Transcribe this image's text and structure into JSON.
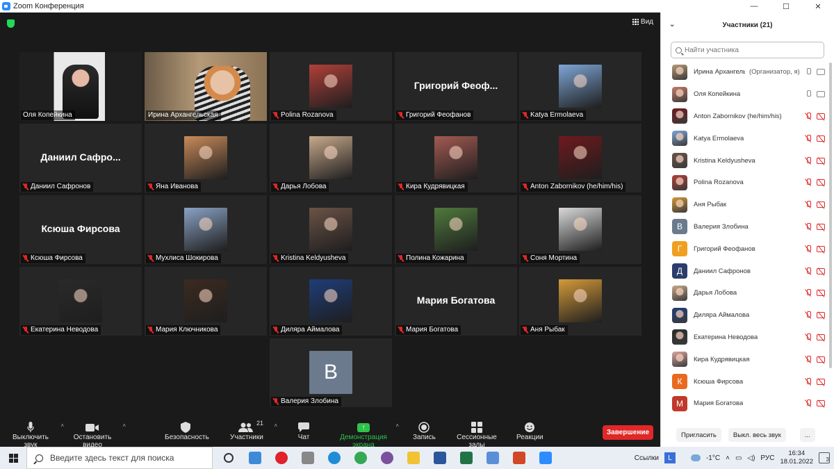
{
  "window": {
    "title": "Zoom Конференция",
    "min": "—",
    "max": "☐",
    "close": "✕"
  },
  "meeting": {
    "view_label": "Вид"
  },
  "tiles": [
    {
      "name": "Оля Копейкина",
      "muted": false,
      "active": true,
      "kind": "video",
      "color": "#e8e8e8"
    },
    {
      "name": "Ирина Архангельская",
      "muted": false,
      "kind": "video",
      "color": "#b59a78"
    },
    {
      "name": "Polina Rozanova",
      "muted": true,
      "kind": "photo",
      "color": "#b0403a"
    },
    {
      "name": "Григорий Феофанов",
      "muted": true,
      "kind": "text",
      "big": "Григорий Феоф..."
    },
    {
      "name": "Katya Ermolaeva",
      "muted": true,
      "kind": "photo",
      "color": "#7ea6d6"
    },
    {
      "name": "Даниил Сафронов",
      "muted": true,
      "kind": "text",
      "big": "Даниил Сафро..."
    },
    {
      "name": "Яна Иванова",
      "muted": true,
      "kind": "photo",
      "color": "#c98a5a"
    },
    {
      "name": "Дарья Лобова",
      "muted": true,
      "kind": "photo",
      "color": "#c7a98c"
    },
    {
      "name": "Кира Кудрявицкая",
      "muted": true,
      "kind": "photo",
      "color": "#a35a52"
    },
    {
      "name": "Anton Zabornikov (he/him/his)",
      "muted": true,
      "kind": "photo",
      "color": "#6e1a1e"
    },
    {
      "name": "Ксюша Фирсова",
      "muted": true,
      "kind": "text",
      "big": "Ксюша Фирсова"
    },
    {
      "name": "Мухлиса Шокирова",
      "muted": true,
      "kind": "photo",
      "color": "#8aa2c4"
    },
    {
      "name": "Kristina Keldyusheva",
      "muted": true,
      "kind": "photo",
      "color": "#6b5346"
    },
    {
      "name": "Полина Кожарина",
      "muted": true,
      "kind": "photo",
      "color": "#4f7a3d"
    },
    {
      "name": "Соня Мортина",
      "muted": true,
      "kind": "photo",
      "color": "#d9d9d9"
    },
    {
      "name": "Екатерина Неводова",
      "muted": true,
      "kind": "photo",
      "color": "#2a2a2a"
    },
    {
      "name": "Мария Ключникова",
      "muted": true,
      "kind": "photo",
      "color": "#3c2a20"
    },
    {
      "name": "Диляра Аймалова",
      "muted": true,
      "kind": "photo",
      "color": "#1f3d7a"
    },
    {
      "name": "Мария Богатова",
      "muted": true,
      "kind": "text",
      "big": "Мария Богатова"
    },
    {
      "name": "Аня Рыбак",
      "muted": true,
      "kind": "photo",
      "color": "#d49a3a"
    },
    {
      "name": "Валерия Злобина",
      "muted": true,
      "kind": "letter",
      "letter": "В",
      "color": "#6b7a8d"
    }
  ],
  "toolbar": {
    "mute": "Выключить звук",
    "video": "Остановить видео",
    "security": "Безопасность",
    "participants": "Участники",
    "participants_count": "21",
    "chat": "Чат",
    "share": "Демонстрация экрана",
    "record": "Запись",
    "rooms": "Сессионные залы",
    "reactions": "Реакции",
    "end": "Завершение"
  },
  "panel": {
    "title": "Участники (21)",
    "search_placeholder": "Найти участника",
    "invite": "Пригласить",
    "mute_all": "Выкл. весь звук",
    "more": "...",
    "participants": [
      {
        "name": "Ирина Архангельская",
        "role": "(Организатор, я)",
        "av": "#b59a78",
        "mic": "on",
        "cam": "on"
      },
      {
        "name": "Оля Копейкина",
        "role": "",
        "av": "#c47d6a",
        "mic": "on",
        "cam": "on"
      },
      {
        "name": "Anton Zabornikov (he/him/his)",
        "role": "",
        "av": "#6e1a1e",
        "mic": "off",
        "cam": "off"
      },
      {
        "name": "Katya Ermolaeva",
        "role": "",
        "av": "#7ea6d6",
        "mic": "off",
        "cam": "off"
      },
      {
        "name": "Kristina Keldyusheva",
        "role": "",
        "av": "#6b5346",
        "mic": "off",
        "cam": "off"
      },
      {
        "name": "Polina Rozanova",
        "role": "",
        "av": "#b0403a",
        "mic": "off",
        "cam": "off"
      },
      {
        "name": "Аня Рыбак",
        "role": "",
        "av": "#d49a3a",
        "mic": "off",
        "cam": "off"
      },
      {
        "name": "Валерия Злобина",
        "role": "",
        "av": "#6b7a8d",
        "letter": "В",
        "mic": "off",
        "cam": "off"
      },
      {
        "name": "Григорий Феофанов",
        "role": "",
        "av": "#f0a020",
        "letter": "Г",
        "mic": "off",
        "cam": "off"
      },
      {
        "name": "Даниил Сафронов",
        "role": "",
        "av": "#2a3d6b",
        "letter": "Д",
        "mic": "off",
        "cam": "off"
      },
      {
        "name": "Дарья Лобова",
        "role": "",
        "av": "#c7a98c",
        "mic": "off",
        "cam": "off"
      },
      {
        "name": "Диляра Аймалова",
        "role": "",
        "av": "#1f3d7a",
        "mic": "off",
        "cam": "off"
      },
      {
        "name": "Екатерина Неводова",
        "role": "",
        "av": "#2a2a2a",
        "mic": "off",
        "cam": "off"
      },
      {
        "name": "Кира Кудрявицкая",
        "role": "",
        "av": "#d8a6a0",
        "mic": "off",
        "cam": "off"
      },
      {
        "name": "Ксюша Фирсова",
        "role": "",
        "av": "#e86a1e",
        "letter": "К",
        "mic": "off",
        "cam": "off"
      },
      {
        "name": "Мария Богатова",
        "role": "",
        "av": "#c0392b",
        "letter": "М",
        "mic": "off",
        "cam": "off"
      }
    ]
  },
  "taskbar": {
    "search_placeholder": "Введите здесь текст для поиска",
    "links_label": "Ссылки",
    "temp": "-1°C",
    "lang": "РУС",
    "time": "16:34",
    "date": "18.01.2022",
    "notif_count": "3",
    "apps": [
      "task-view",
      "photos",
      "opera",
      "printer",
      "edge",
      "chrome",
      "viber",
      "explorer",
      "word",
      "excel",
      "photos2",
      "powerpoint",
      "zoom"
    ]
  }
}
